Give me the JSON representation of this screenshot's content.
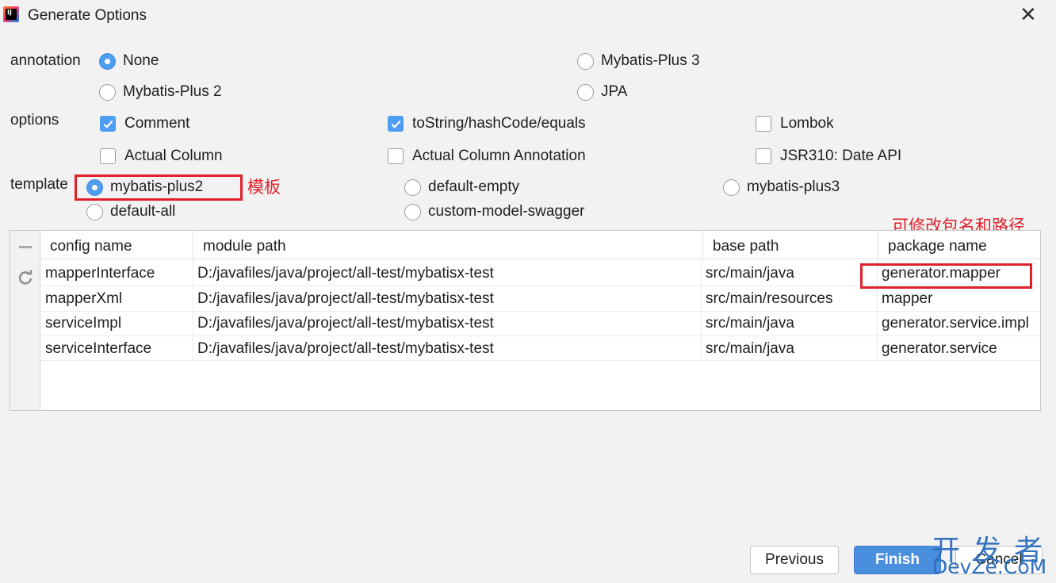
{
  "window": {
    "title": "Generate Options",
    "close_glyph": "✕"
  },
  "annotation": {
    "label": "annotation",
    "options": [
      {
        "label": "None",
        "selected": true
      },
      {
        "label": "Mybatis-Plus 3",
        "selected": false
      },
      {
        "label": "Mybatis-Plus 2",
        "selected": false
      },
      {
        "label": "JPA",
        "selected": false
      }
    ]
  },
  "options": {
    "label": "options",
    "items": [
      {
        "label": "Comment",
        "checked": true
      },
      {
        "label": "toString/hashCode/equals",
        "checked": true
      },
      {
        "label": "Lombok",
        "checked": false
      },
      {
        "label": "Actual Column",
        "checked": false
      },
      {
        "label": "Actual Column Annotation",
        "checked": false
      },
      {
        "label": "JSR310: Date API",
        "checked": false
      }
    ]
  },
  "template": {
    "label": "template",
    "options": [
      {
        "label": "mybatis-plus2",
        "selected": true
      },
      {
        "label": "default-empty",
        "selected": false
      },
      {
        "label": "mybatis-plus3",
        "selected": false
      },
      {
        "label": "default-all",
        "selected": false
      },
      {
        "label": "custom-model-swagger",
        "selected": false
      }
    ]
  },
  "annotations_overlay": {
    "template_note": "模板",
    "package_note": "可修改包名和路径",
    "color": "#e0212b"
  },
  "table": {
    "columns": [
      "config name",
      "module path",
      "base path",
      "package name"
    ],
    "rows": [
      [
        "mapperInterface",
        "D:/javafiles/java/project/all-test/mybatisx-test",
        "src/main/java",
        "generator.mapper"
      ],
      [
        "mapperXml",
        "D:/javafiles/java/project/all-test/mybatisx-test",
        "src/main/resources",
        "mapper"
      ],
      [
        "serviceImpl",
        "D:/javafiles/java/project/all-test/mybatisx-test",
        "src/main/java",
        "generator.service.impl"
      ],
      [
        "serviceInterface",
        "D:/javafiles/java/project/all-test/mybatisx-test",
        "src/main/java",
        "generator.service"
      ]
    ]
  },
  "buttons": {
    "previous": "Previous",
    "finish": "Finish",
    "cancel": "Cancel"
  },
  "watermark": {
    "line1": "开发者",
    "line2": "DevZe.CoM"
  },
  "colors": {
    "accent": "#4d9df0",
    "finish_button": "#4a8fde",
    "highlight_red": "#e0212b"
  }
}
